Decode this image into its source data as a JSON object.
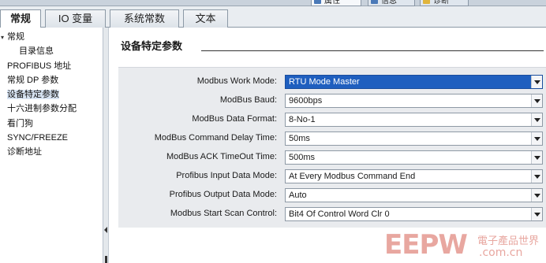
{
  "top_tabs": [
    {
      "label": "属性"
    },
    {
      "label": "信息"
    },
    {
      "label": "诊断"
    }
  ],
  "tabs": [
    {
      "label": "常规"
    },
    {
      "label": "IO 变量"
    },
    {
      "label": "系统常数"
    },
    {
      "label": "文本"
    }
  ],
  "nav": [
    {
      "label": "常规"
    },
    {
      "label": "目录信息"
    },
    {
      "label": "PROFIBUS 地址"
    },
    {
      "label": "常规 DP 参数"
    },
    {
      "label": "设备特定参数"
    },
    {
      "label": "十六进制参数分配"
    },
    {
      "label": "看门狗"
    },
    {
      "label": "SYNC/FREEZE"
    },
    {
      "label": "诊断地址"
    }
  ],
  "section": {
    "title": "设备特定参数"
  },
  "params": [
    {
      "label": "Modbus Work Mode:",
      "value": "RTU Mode Master"
    },
    {
      "label": "ModBus Baud:",
      "value": "9600bps"
    },
    {
      "label": "ModBus Data Format:",
      "value": "8-No-1"
    },
    {
      "label": "ModBus Command Delay Time:",
      "value": "50ms"
    },
    {
      "label": "ModBus ACK TimeOut Time:",
      "value": "500ms"
    },
    {
      "label": "Profibus Input Data Mode:",
      "value": "At Every Modbus Command End"
    },
    {
      "label": "Profibus Output Data Mode:",
      "value": "Auto"
    },
    {
      "label": "Modbus Start Scan Control:",
      "value": "Bit4 Of Control Word Clr 0"
    }
  ],
  "watermark": {
    "logo": "EEPW",
    "cn": "電子產品世界",
    "domain": ".com.cn"
  },
  "colors": {
    "selection": "#1f5fbf",
    "panel": "#e9ebee",
    "watermark": "#e8a7a0"
  }
}
